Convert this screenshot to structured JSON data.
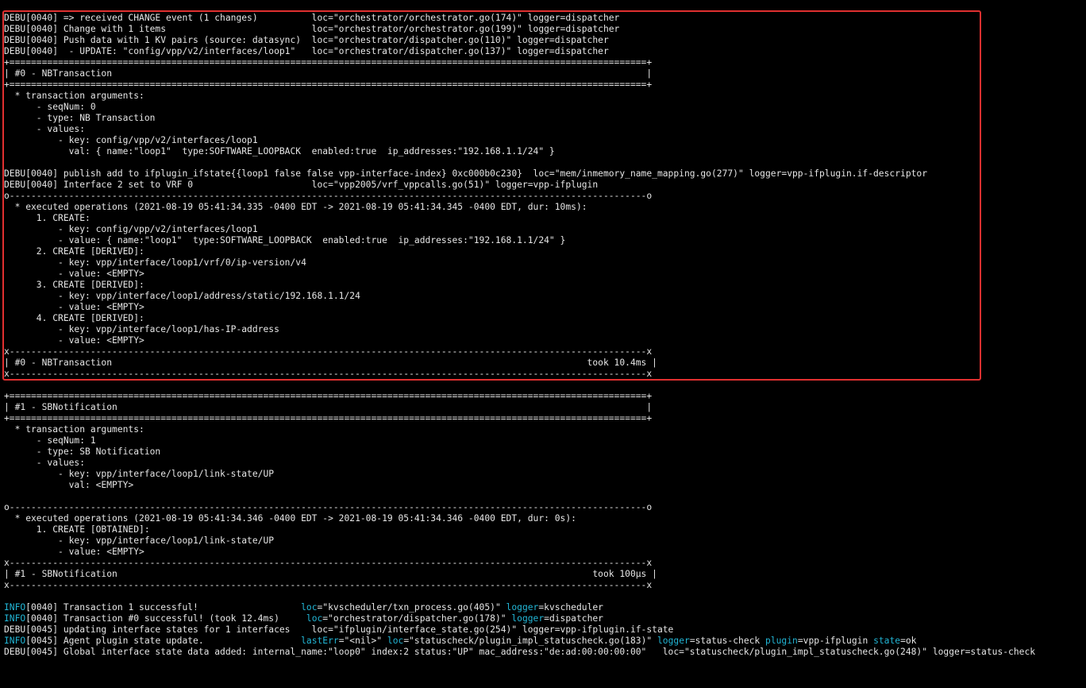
{
  "colors": {
    "background": "#000000",
    "text": "#e6e6e6",
    "info": "#22b6d6",
    "highlight": "#e03030"
  },
  "highlight_box": {
    "label": "#0 - NBTransaction"
  },
  "lines": [
    [
      {
        "t": "DEBU[0040] => received CHANGE event (1 changes)          loc=\"orchestrator/orchestrator.go(174)\" logger=dispatcher"
      }
    ],
    [
      {
        "t": "DEBU[0040] Change with 1 items                           loc=\"orchestrator/orchestrator.go(199)\" logger=dispatcher"
      }
    ],
    [
      {
        "t": "DEBU[0040] Push data with 1 KV pairs (source: datasync)  loc=\"orchestrator/dispatcher.go(110)\" logger=dispatcher"
      }
    ],
    [
      {
        "t": "DEBU[0040]  - UPDATE: \"config/vpp/v2/interfaces/loop1\"   loc=\"orchestrator/dispatcher.go(137)\" logger=dispatcher"
      }
    ],
    [
      {
        "t": "+======================================================================================================================+"
      }
    ],
    [
      {
        "t": "| #0 - NBTransaction                                                                                                   |"
      }
    ],
    [
      {
        "t": "+======================================================================================================================+"
      }
    ],
    [
      {
        "t": "  * transaction arguments:"
      }
    ],
    [
      {
        "t": "      - seqNum: 0"
      }
    ],
    [
      {
        "t": "      - type: NB Transaction"
      }
    ],
    [
      {
        "t": "      - values:"
      }
    ],
    [
      {
        "t": "          - key: config/vpp/v2/interfaces/loop1"
      }
    ],
    [
      {
        "t": "            val: { name:\"loop1\"  type:SOFTWARE_LOOPBACK  enabled:true  ip_addresses:\"192.168.1.1/24\" }"
      }
    ],
    [
      {
        "t": ""
      }
    ],
    [
      {
        "t": "DEBU[0040] publish add to ifplugin_ifstate{{loop1 false false vpp-interface-index} 0xc000b0c230}  loc=\"mem/inmemory_name_mapping.go(277)\" logger=vpp-ifplugin.if-descriptor"
      }
    ],
    [
      {
        "t": "DEBU[0040] Interface 2 set to VRF 0                      loc=\"vpp2005/vrf_vppcalls.go(51)\" logger=vpp-ifplugin"
      }
    ],
    [
      {
        "t": "o----------------------------------------------------------------------------------------------------------------------o"
      }
    ],
    [
      {
        "t": "  * executed operations (2021-08-19 05:41:34.335 -0400 EDT -> 2021-08-19 05:41:34.345 -0400 EDT, dur: 10ms):"
      }
    ],
    [
      {
        "t": "      1. CREATE:"
      }
    ],
    [
      {
        "t": "          - key: config/vpp/v2/interfaces/loop1"
      }
    ],
    [
      {
        "t": "          - value: { name:\"loop1\"  type:SOFTWARE_LOOPBACK  enabled:true  ip_addresses:\"192.168.1.1/24\" }"
      }
    ],
    [
      {
        "t": "      2. CREATE [DERIVED]:"
      }
    ],
    [
      {
        "t": "          - key: vpp/interface/loop1/vrf/0/ip-version/v4"
      }
    ],
    [
      {
        "t": "          - value: <EMPTY>"
      }
    ],
    [
      {
        "t": "      3. CREATE [DERIVED]:"
      }
    ],
    [
      {
        "t": "          - key: vpp/interface/loop1/address/static/192.168.1.1/24"
      }
    ],
    [
      {
        "t": "          - value: <EMPTY>"
      }
    ],
    [
      {
        "t": "      4. CREATE [DERIVED]:"
      }
    ],
    [
      {
        "t": "          - key: vpp/interface/loop1/has-IP-address"
      }
    ],
    [
      {
        "t": "          - value: <EMPTY>"
      }
    ],
    [
      {
        "t": "x----------------------------------------------------------------------------------------------------------------------x"
      }
    ],
    [
      {
        "t": "| #0 - NBTransaction                                                                                        took 10.4ms |"
      }
    ],
    [
      {
        "t": "x----------------------------------------------------------------------------------------------------------------------x"
      }
    ],
    [
      {
        "t": ""
      }
    ],
    [
      {
        "t": "+======================================================================================================================+"
      }
    ],
    [
      {
        "t": "| #1 - SBNotification                                                                                                  |"
      }
    ],
    [
      {
        "t": "+======================================================================================================================+"
      }
    ],
    [
      {
        "t": "  * transaction arguments:"
      }
    ],
    [
      {
        "t": "      - seqNum: 1"
      }
    ],
    [
      {
        "t": "      - type: SB Notification"
      }
    ],
    [
      {
        "t": "      - values:"
      }
    ],
    [
      {
        "t": "          - key: vpp/interface/loop1/link-state/UP"
      }
    ],
    [
      {
        "t": "            val: <EMPTY>"
      }
    ],
    [
      {
        "t": ""
      }
    ],
    [
      {
        "t": "o----------------------------------------------------------------------------------------------------------------------o"
      }
    ],
    [
      {
        "t": "  * executed operations (2021-08-19 05:41:34.346 -0400 EDT -> 2021-08-19 05:41:34.346 -0400 EDT, dur: 0s):"
      }
    ],
    [
      {
        "t": "      1. CREATE [OBTAINED]:"
      }
    ],
    [
      {
        "t": "          - key: vpp/interface/loop1/link-state/UP"
      }
    ],
    [
      {
        "t": "          - value: <EMPTY>"
      }
    ],
    [
      {
        "t": "x----------------------------------------------------------------------------------------------------------------------x"
      }
    ],
    [
      {
        "t": "| #1 - SBNotification                                                                                        took 100µs |"
      }
    ],
    [
      {
        "t": "x----------------------------------------------------------------------------------------------------------------------x"
      }
    ],
    [
      {
        "t": ""
      }
    ],
    [
      {
        "t": "INFO",
        "c": "info"
      },
      {
        "t": "[0040] Transaction 1 successful!                   "
      },
      {
        "t": "loc",
        "c": "key"
      },
      {
        "t": "=\"kvscheduler/txn_process.go(405)\" "
      },
      {
        "t": "logger",
        "c": "key"
      },
      {
        "t": "=kvscheduler"
      }
    ],
    [
      {
        "t": "INFO",
        "c": "info"
      },
      {
        "t": "[0040] Transaction #0 successful! (took 12.4ms)     "
      },
      {
        "t": "loc",
        "c": "key"
      },
      {
        "t": "=\"orchestrator/dispatcher.go(178)\" "
      },
      {
        "t": "logger",
        "c": "key"
      },
      {
        "t": "=dispatcher"
      }
    ],
    [
      {
        "t": "DEBU[0045] updating interface states for 1 interfaces    loc=\"ifplugin/interface_state.go(254)\" logger=vpp-ifplugin.if-state"
      }
    ],
    [
      {
        "t": "INFO",
        "c": "info"
      },
      {
        "t": "[0045] Agent plugin state update.                  "
      },
      {
        "t": "lastErr",
        "c": "key"
      },
      {
        "t": "=\"<nil>\" "
      },
      {
        "t": "loc",
        "c": "key"
      },
      {
        "t": "=\"statuscheck/plugin_impl_statuscheck.go(183)\" "
      },
      {
        "t": "logger",
        "c": "key"
      },
      {
        "t": "=status-check "
      },
      {
        "t": "plugin",
        "c": "key"
      },
      {
        "t": "=vpp-ifplugin "
      },
      {
        "t": "state",
        "c": "key"
      },
      {
        "t": "=ok"
      }
    ],
    [
      {
        "t": "DEBU[0045] Global interface state data added: internal_name:\"loop0\" index:2 status:\"UP\" mac_address:\"de:ad:00:00:00:00\"   loc=\"statuscheck/plugin_impl_statuscheck.go(248)\" logger=status-check"
      }
    ]
  ]
}
